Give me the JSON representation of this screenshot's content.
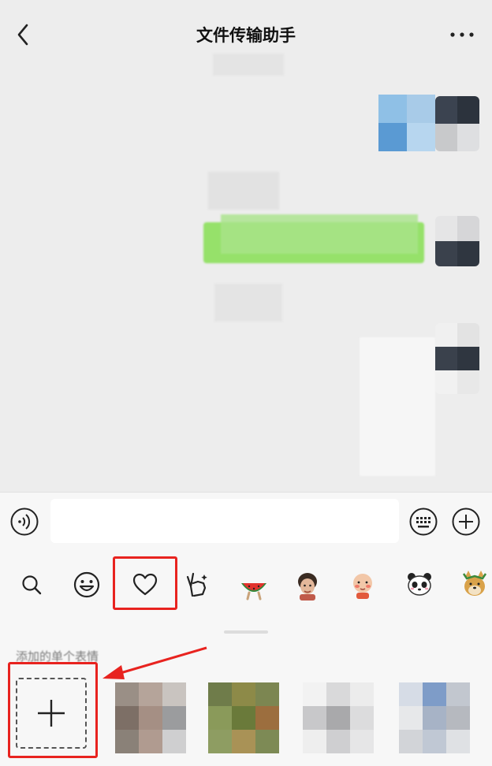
{
  "header": {
    "title": "文件传输助手",
    "back_icon": "chevron-left-icon",
    "more_icon": "ellipsis-icon"
  },
  "input_bar": {
    "voice_icon": "voice-icon",
    "placeholder": "",
    "keyboard_icon": "keyboard-icon",
    "plus_icon": "plus-circle-icon"
  },
  "emoji_tabs": [
    {
      "name": "search",
      "icon": "search-icon"
    },
    {
      "name": "emoji",
      "icon": "smiley-icon"
    },
    {
      "name": "favorites",
      "icon": "heart-icon",
      "highlighted": true
    },
    {
      "name": "gesture",
      "icon": "peace-hand-icon"
    },
    {
      "name": "sticker-pack-1",
      "icon": "watermelon-sticker-icon"
    },
    {
      "name": "sticker-pack-2",
      "icon": "child-sticker-icon"
    },
    {
      "name": "sticker-pack-3",
      "icon": "face-sticker-icon"
    },
    {
      "name": "sticker-pack-4",
      "icon": "panda-sticker-icon"
    },
    {
      "name": "sticker-pack-5",
      "icon": "doge-sticker-icon"
    }
  ],
  "panel": {
    "section_label": "添加的单个表情",
    "add_icon": "plus-icon"
  },
  "colors": {
    "highlight": "#e8231f",
    "bubble_green": "#95ec69",
    "background": "#ededed"
  }
}
